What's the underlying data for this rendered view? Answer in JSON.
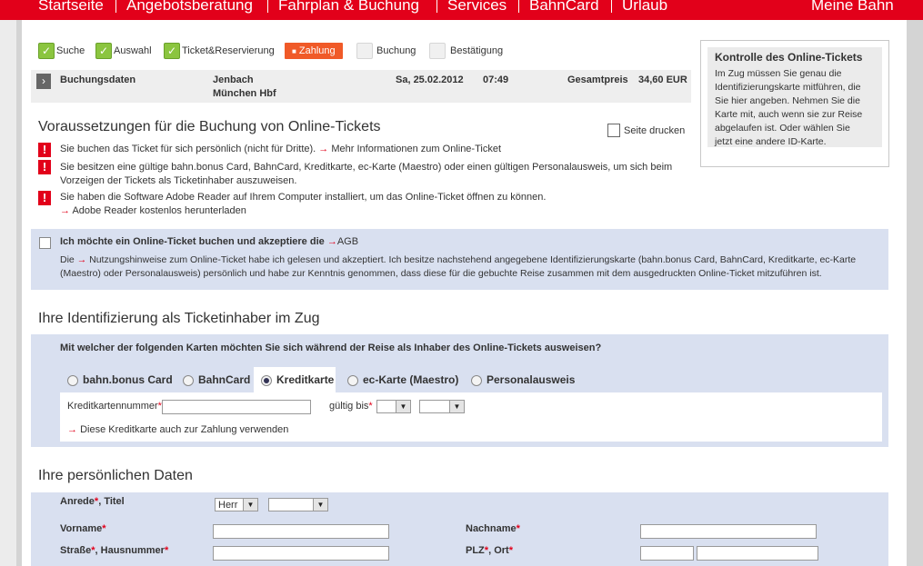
{
  "nav": {
    "items": [
      "Startseite",
      "Angebotsberatung",
      "Fahrplan & Buchung",
      "Services",
      "BahnCard",
      "Urlaub"
    ],
    "right": "Meine Bahn"
  },
  "steps": [
    {
      "label": "Suche",
      "state": "done"
    },
    {
      "label": "Auswahl",
      "state": "done"
    },
    {
      "label": "Ticket&Reservierung",
      "state": "done"
    },
    {
      "label": "Zahlung",
      "state": "active"
    },
    {
      "label": "Buchung",
      "state": "todo"
    },
    {
      "label": "Bestätigung",
      "state": "todo"
    }
  ],
  "booking": {
    "label": "Buchungsdaten",
    "from": "Jenbach",
    "to": "München Hbf",
    "date": "Sa, 25.02.2012",
    "time": "07:49",
    "total_label": "Gesamtpreis",
    "total_value": "34,60 EUR"
  },
  "requirements": {
    "title": "Voraussetzungen für die Buchung von Online-Tickets",
    "print": "Seite drucken",
    "items": [
      {
        "text": "Sie buchen das Ticket für sich persönlich (nicht für Dritte).",
        "link": "Mehr Informationen zum Online-Ticket"
      },
      {
        "line1": "Sie besitzen eine gültige bahn.bonus Card, BahnCard, Kreditkarte, ec-Karte (Maestro) oder einen gültigen Personalausweis, um sich beim",
        "line2": "Vorzeigen der Tickets als Ticketinhaber auszuweisen."
      },
      {
        "text": "Sie haben die Software Adobe Reader auf Ihrem Computer installiert, um das Online-Ticket öffnen zu können.",
        "link": "Adobe Reader kostenlos herunterladen"
      }
    ]
  },
  "accept": {
    "label": "Ich möchte ein Online-Ticket buchen und akzeptiere die",
    "agb": "AGB",
    "line1_pre": "Die",
    "line1_link": "Nutzungshinweise",
    "line1_post": "zum Online-Ticket habe ich gelesen und akzeptiert. Ich besitze nachstehend angegebene Identifizierungskarte (bahn.bonus Card, BahnCard, Kreditkarte, ec-Karte",
    "line2": "(Maestro) oder Personalausweis) persönlich und habe zur Kenntnis genommen, dass diese für die gebuchte Reise zusammen mit dem ausgedruckten Online-Ticket mitzuführen ist."
  },
  "ident": {
    "title": "Ihre Identifizierung als Ticketinhaber im Zug",
    "question": "Mit welcher der folgenden Karten möchten Sie sich während der Reise als Inhaber des Online-Tickets ausweisen?",
    "options": [
      "bahn.bonus Card",
      "BahnCard",
      "Kreditkarte",
      "ec-Karte (Maestro)",
      "Personalausweis"
    ],
    "selected": "Kreditkarte",
    "card_number_label": "Kreditkartennummer",
    "valid_label": "gültig bis",
    "use_for_payment": "Diese Kreditkarte auch zur Zahlung verwenden"
  },
  "personal": {
    "title": "Ihre persönlichen Daten",
    "salutation_label": "Anrede",
    "title_label": "Titel",
    "salutation_value": "Herr",
    "firstname_label": "Vorname",
    "lastname_label": "Nachname",
    "street_label": "Straße",
    "housenr_label": "Hausnummer",
    "zip_label": "PLZ",
    "city_label": "Ort",
    "req_mark": "*"
  },
  "infobox": {
    "title": "Kontrolle des Online-Tickets",
    "lines": [
      "Im Zug müssen Sie genau die",
      "Identifizierungskarte mitführen, die",
      "Sie hier angeben. Nehmen Sie die",
      "Karte mit, auch wenn sie zur Reise",
      "abgelaufen ist. Oder wählen Sie",
      "jetzt eine andere ID-Karte."
    ]
  },
  "colors": {
    "brand": "#e2001a",
    "active_step": "#f05a28",
    "check": "#8bc53f",
    "blue_box": "#d9e0f0"
  }
}
